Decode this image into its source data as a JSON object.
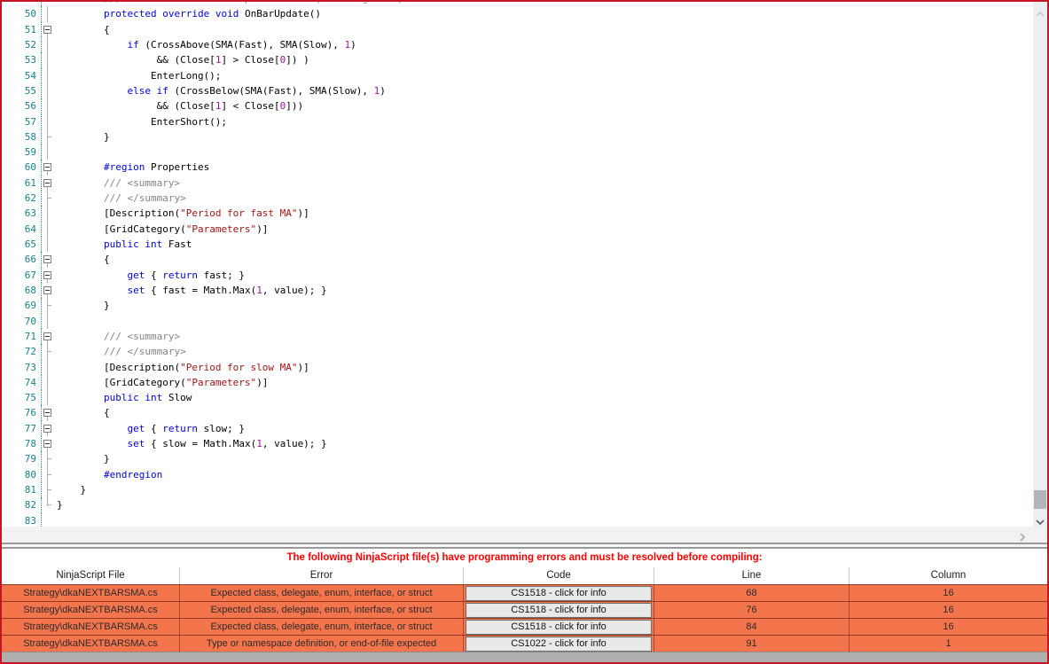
{
  "colors": {
    "border": "#C41425",
    "error_row": "#F4744C",
    "banner_text": "#FF0000",
    "keyword": "#0000E0",
    "string": "#A31515",
    "number": "#9B169B",
    "comment": "#838383",
    "line_number": "#17808A",
    "gutter_sep": "#2E8F8F"
  },
  "editor": {
    "lines": [
      {
        "n": "",
        "f": "",
        "s": [
          [
            "c",
            "        /// Called on each bar update event (incoming tick)"
          ]
        ]
      },
      {
        "n": "50",
        "f": "line",
        "s": [
          [
            "p",
            "        "
          ],
          [
            "k",
            "protected"
          ],
          [
            "p",
            " "
          ],
          [
            "k",
            "override"
          ],
          [
            "p",
            " "
          ],
          [
            "k",
            "void"
          ],
          [
            "p",
            " OnBarUpdate()"
          ]
        ]
      },
      {
        "n": "51",
        "f": "box",
        "s": [
          [
            "p",
            "        {"
          ]
        ]
      },
      {
        "n": "52",
        "f": "line",
        "s": [
          [
            "p",
            "            "
          ],
          [
            "k",
            "if"
          ],
          [
            "p",
            " (CrossAbove(SMA(Fast), SMA(Slow), "
          ],
          [
            "n2",
            "1"
          ],
          [
            "p",
            ")"
          ]
        ]
      },
      {
        "n": "53",
        "f": "line",
        "s": [
          [
            "p",
            "                 && (Close["
          ],
          [
            "n2",
            "1"
          ],
          [
            "p",
            "] > Close["
          ],
          [
            "n2",
            "0"
          ],
          [
            "p",
            "]) )"
          ]
        ]
      },
      {
        "n": "54",
        "f": "line",
        "s": [
          [
            "p",
            "                EnterLong();"
          ]
        ]
      },
      {
        "n": "55",
        "f": "line",
        "s": [
          [
            "p",
            "            "
          ],
          [
            "k",
            "else"
          ],
          [
            "p",
            " "
          ],
          [
            "k",
            "if"
          ],
          [
            "p",
            " (CrossBelow(SMA(Fast), SMA(Slow), "
          ],
          [
            "n2",
            "1"
          ],
          [
            "p",
            ")"
          ]
        ]
      },
      {
        "n": "56",
        "f": "line",
        "s": [
          [
            "p",
            "                 && (Close["
          ],
          [
            "n2",
            "1"
          ],
          [
            "p",
            "] < Close["
          ],
          [
            "n2",
            "0"
          ],
          [
            "p",
            "]))"
          ]
        ]
      },
      {
        "n": "57",
        "f": "line",
        "s": [
          [
            "p",
            "                EnterShort();"
          ]
        ]
      },
      {
        "n": "58",
        "f": "tick",
        "s": [
          [
            "p",
            "        }"
          ]
        ]
      },
      {
        "n": "59",
        "f": "line",
        "s": []
      },
      {
        "n": "60",
        "f": "box",
        "s": [
          [
            "p",
            "        "
          ],
          [
            "k",
            "#region"
          ],
          [
            "p",
            " Properties"
          ]
        ]
      },
      {
        "n": "61",
        "f": "box",
        "s": [
          [
            "c",
            "        /// <summary>"
          ]
        ]
      },
      {
        "n": "62",
        "f": "tick",
        "s": [
          [
            "c",
            "        /// </summary>"
          ]
        ]
      },
      {
        "n": "63",
        "f": "line",
        "s": [
          [
            "p",
            "        [Description("
          ],
          [
            "s",
            "\"Period for fast MA\""
          ],
          [
            "p",
            ")]"
          ]
        ]
      },
      {
        "n": "64",
        "f": "line",
        "s": [
          [
            "p",
            "        [GridCategory("
          ],
          [
            "s",
            "\"Parameters\""
          ],
          [
            "p",
            ")]"
          ]
        ]
      },
      {
        "n": "65",
        "f": "line",
        "s": [
          [
            "p",
            "        "
          ],
          [
            "k",
            "public"
          ],
          [
            "p",
            " "
          ],
          [
            "k",
            "int"
          ],
          [
            "p",
            " Fast"
          ]
        ]
      },
      {
        "n": "66",
        "f": "box",
        "s": [
          [
            "p",
            "        {"
          ]
        ]
      },
      {
        "n": "67",
        "f": "box",
        "s": [
          [
            "p",
            "            "
          ],
          [
            "k",
            "get"
          ],
          [
            "p",
            " { "
          ],
          [
            "k",
            "return"
          ],
          [
            "p",
            " fast; }"
          ]
        ]
      },
      {
        "n": "68",
        "f": "box",
        "s": [
          [
            "p",
            "            "
          ],
          [
            "k",
            "set"
          ],
          [
            "p",
            " { fast = Math.Max("
          ],
          [
            "n2",
            "1"
          ],
          [
            "p",
            ", value); }"
          ]
        ]
      },
      {
        "n": "69",
        "f": "tick",
        "s": [
          [
            "p",
            "        }"
          ]
        ]
      },
      {
        "n": "70",
        "f": "line",
        "s": []
      },
      {
        "n": "71",
        "f": "box",
        "s": [
          [
            "c",
            "        /// <summary>"
          ]
        ]
      },
      {
        "n": "72",
        "f": "tick",
        "s": [
          [
            "c",
            "        /// </summary>"
          ]
        ]
      },
      {
        "n": "73",
        "f": "line",
        "s": [
          [
            "p",
            "        [Description("
          ],
          [
            "s",
            "\"Period for slow MA\""
          ],
          [
            "p",
            ")]"
          ]
        ]
      },
      {
        "n": "74",
        "f": "line",
        "s": [
          [
            "p",
            "        [GridCategory("
          ],
          [
            "s",
            "\"Parameters\""
          ],
          [
            "p",
            ")]"
          ]
        ]
      },
      {
        "n": "75",
        "f": "line",
        "s": [
          [
            "p",
            "        "
          ],
          [
            "k",
            "public"
          ],
          [
            "p",
            " "
          ],
          [
            "k",
            "int"
          ],
          [
            "p",
            " Slow"
          ]
        ]
      },
      {
        "n": "76",
        "f": "box",
        "s": [
          [
            "p",
            "        {"
          ]
        ]
      },
      {
        "n": "77",
        "f": "box",
        "s": [
          [
            "p",
            "            "
          ],
          [
            "k",
            "get"
          ],
          [
            "p",
            " { "
          ],
          [
            "k",
            "return"
          ],
          [
            "p",
            " slow; }"
          ]
        ]
      },
      {
        "n": "78",
        "f": "box",
        "s": [
          [
            "p",
            "            "
          ],
          [
            "k",
            "set"
          ],
          [
            "p",
            " { slow = Math.Max("
          ],
          [
            "n2",
            "1"
          ],
          [
            "p",
            ", value); }"
          ]
        ]
      },
      {
        "n": "79",
        "f": "tick",
        "s": [
          [
            "p",
            "        }"
          ]
        ]
      },
      {
        "n": "80",
        "f": "tick",
        "s": [
          [
            "p",
            "        "
          ],
          [
            "k",
            "#endregion"
          ]
        ]
      },
      {
        "n": "81",
        "f": "tick",
        "s": [
          [
            "p",
            "    }"
          ]
        ]
      },
      {
        "n": "82",
        "f": "end",
        "s": [
          [
            "p",
            "}"
          ]
        ]
      },
      {
        "n": "83",
        "f": "",
        "s": []
      }
    ]
  },
  "error_panel": {
    "banner": "The following NinjaScript file(s) have programming errors and must be resolved before compiling:",
    "columns": [
      "NinjaScript File",
      "Error",
      "Code",
      "Line",
      "Column"
    ],
    "rows": [
      {
        "file": "Strategy\\dkaNEXTBARSMA.cs",
        "error": "Expected class, delegate, enum, interface, or struct",
        "code": "CS1518 - click for info",
        "line": "68",
        "column": "16"
      },
      {
        "file": "Strategy\\dkaNEXTBARSMA.cs",
        "error": "Expected class, delegate, enum, interface, or struct",
        "code": "CS1518 - click for info",
        "line": "76",
        "column": "16"
      },
      {
        "file": "Strategy\\dkaNEXTBARSMA.cs",
        "error": "Expected class, delegate, enum, interface, or struct",
        "code": "CS1518 - click for info",
        "line": "84",
        "column": "16"
      },
      {
        "file": "Strategy\\dkaNEXTBARSMA.cs",
        "error": "Type or namespace definition, or end-of-file expected",
        "code": "CS1022 - click for info",
        "line": "91",
        "column": "1"
      }
    ]
  }
}
